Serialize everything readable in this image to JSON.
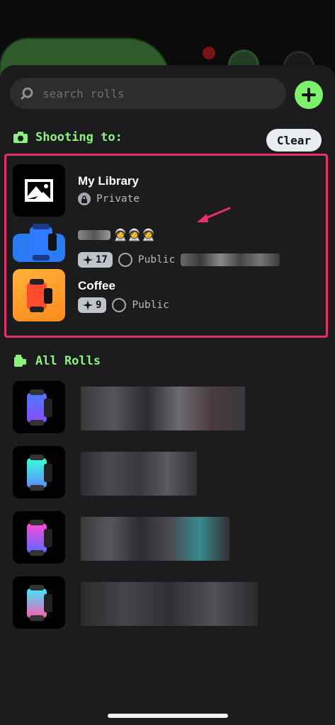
{
  "search": {
    "placeholder": "search rolls",
    "value": ""
  },
  "shooting": {
    "heading": "Shooting to:",
    "clear_label": "Clear",
    "rows": [
      {
        "title": "My Library",
        "privacy": "Private"
      },
      {
        "title": "🧑‍🚀🧑‍🚀🧑‍🚀",
        "count": "17",
        "privacy": "Public"
      },
      {
        "title": "Coffee",
        "count": "9",
        "privacy": "Public"
      }
    ]
  },
  "all_rolls": {
    "heading": "All Rolls"
  },
  "colors": {
    "accent_green": "#7df06b",
    "highlight_pink": "#e8306a",
    "sheet_bg": "#1c1c1e"
  },
  "icons": [
    "search-icon",
    "plus-icon",
    "camera-icon",
    "lock-icon",
    "globe-icon",
    "spark-icon",
    "film-icon",
    "arrow-icon"
  ]
}
